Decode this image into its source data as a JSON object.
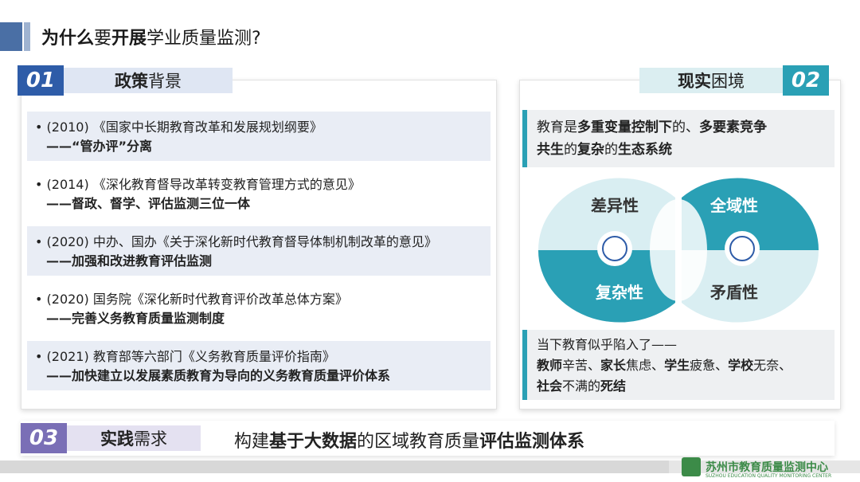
{
  "page_title": {
    "bold1": "为什么",
    "normal1": "要",
    "bold2": "开展",
    "normal2": "学业质量监测?"
  },
  "section1": {
    "number": "01",
    "bold": "政策",
    "normal": "背景",
    "items": [
      {
        "line1": "• (2010) 《国家中长期教育改革和发展规划纲要》",
        "line2": "——“管办评”分离"
      },
      {
        "line1": "• (2014) 《深化教育督导改革转变教育管理方式的意见》",
        "line2": "——督政、督学、评估监测三位一体"
      },
      {
        "line1": "• (2020) 中办、国办《关于深化新时代教育督导体制机制改革的意见》",
        "line2": "——加强和改进教育评估监测"
      },
      {
        "line1": "• (2020) 国务院《深化新时代教育评价改革总体方案》",
        "line2": "——完善义务教育质量监测制度"
      },
      {
        "line1": "• (2021) 教育部等六部门《义务教育质量评价指南》",
        "line2": "——加快建立以发展素质教育为导向的义务教育质量评价体系"
      }
    ]
  },
  "section2": {
    "number": "02",
    "bold": "现实",
    "normal": "困境",
    "callout1": {
      "line1_a": "教育是",
      "line1_b": "多重变量控制下",
      "line1_c": "的、",
      "line1_d": "多要素竞争",
      "line2_a": "共生",
      "line2_b": "的",
      "line2_c": "复杂",
      "line2_d": "的",
      "line2_e": "生态系统"
    },
    "diagram": {
      "top_left": "差异性",
      "top_right": "全域性",
      "bottom_left": "复杂性",
      "bottom_right": "矛盾性",
      "colors": {
        "teal": "#2aa0b5",
        "light": "#d9eef2"
      }
    },
    "callout2": {
      "line1": "当下教育似乎陷入了——",
      "line2_a": "教师",
      "line2_b": "辛苦、",
      "line2_c": "家长",
      "line2_d": "焦虑、",
      "line2_e": "学生",
      "line2_f": "疲惫、",
      "line2_g": "学校",
      "line2_h": "无奈、",
      "line3_a": "社会",
      "line3_b": "不满的",
      "line3_c": "死结"
    }
  },
  "section3": {
    "number": "03",
    "bold": "实践",
    "normal": "需求",
    "text_a": "构建",
    "text_b": "基于大数据",
    "text_c": "的区域教育质量",
    "text_d": "评估监测体系"
  },
  "logo": {
    "name": "苏州市教育质量监测中心",
    "sub": "SUZHOU EDUCATION QUALITY MONITORING CENTER"
  }
}
